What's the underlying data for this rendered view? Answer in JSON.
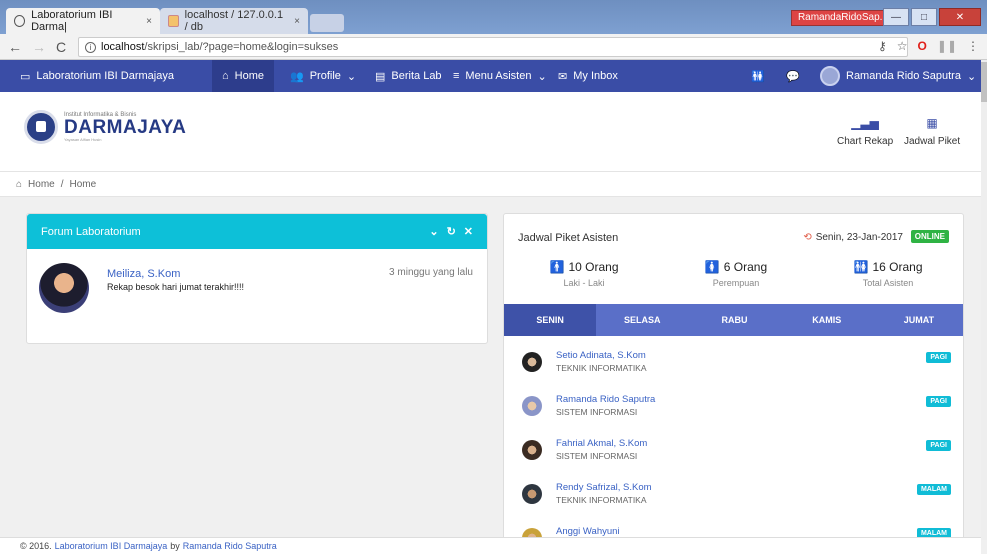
{
  "browser": {
    "tabs": [
      {
        "title": "Laboratorium IBI Darma|",
        "close": "×"
      },
      {
        "title": "localhost / 127.0.0.1 / db",
        "close": "×"
      }
    ],
    "profile": "RamandaRidoSap...",
    "window": {
      "minimize": "—",
      "maximize": "□",
      "close": "✕"
    },
    "url_scheme": "localhost",
    "url": "/skripsi_lab/?page=home&login=sukses"
  },
  "navbar": {
    "brand": "Laboratorium IBI Darmajaya",
    "home": "Home",
    "profile": "Profile",
    "berita": "Berita Lab",
    "menu_asisten": "Menu Asisten",
    "inbox": "My Inbox",
    "user": "Ramanda Rido Saputra"
  },
  "header": {
    "logo_small": "Institut Informatika & Bisnis",
    "logo_big": "DARMAJAYA",
    "logo_tiny": "Yayasan Alfian Husin",
    "chart_rekap": "Chart Rekap",
    "jadwal_piket": "Jadwal Piket"
  },
  "breadcrumb": {
    "home": "Home",
    "sep": "/",
    "current": "Home"
  },
  "forum": {
    "title": "Forum Laboratorium",
    "post": {
      "name": "Meiliza, S.Kom",
      "text": "Rekap besok hari jumat terakhir!!!!",
      "time": "3 minggu yang lalu"
    }
  },
  "jadwal": {
    "title": "Jadwal Piket Asisten",
    "date": "Senin, 23-Jan-2017",
    "status": "ONLINE",
    "stats": [
      {
        "num": "10 Orang",
        "label": "Laki - Laki"
      },
      {
        "num": "6 Orang",
        "label": "Perempuan"
      },
      {
        "num": "16 Orang",
        "label": "Total Asisten"
      }
    ],
    "days": [
      "SENIN",
      "SELASA",
      "RABU",
      "KAMIS",
      "JUMAT"
    ],
    "asisten": [
      {
        "name": "Setio Adinata, S.Kom",
        "prodi": "TEKNIK INFORMATIKA",
        "shift": "PAGI"
      },
      {
        "name": "Ramanda Rido Saputra",
        "prodi": "SISTEM INFORMASI",
        "shift": "PAGI"
      },
      {
        "name": "Fahrial Akmal, S.Kom",
        "prodi": "SISTEM INFORMASI",
        "shift": "PAGI"
      },
      {
        "name": "Rendy Safrizal, S.Kom",
        "prodi": "TEKNIK INFORMATIKA",
        "shift": "MALAM"
      },
      {
        "name": "Anggi Wahyuni",
        "prodi": "",
        "shift": "MALAM"
      }
    ]
  },
  "footer": {
    "copyright": "© 2016.",
    "site": "Laboratorium IBI Darmajaya",
    "by": "by",
    "author": "Ramanda Rido Saputra"
  }
}
